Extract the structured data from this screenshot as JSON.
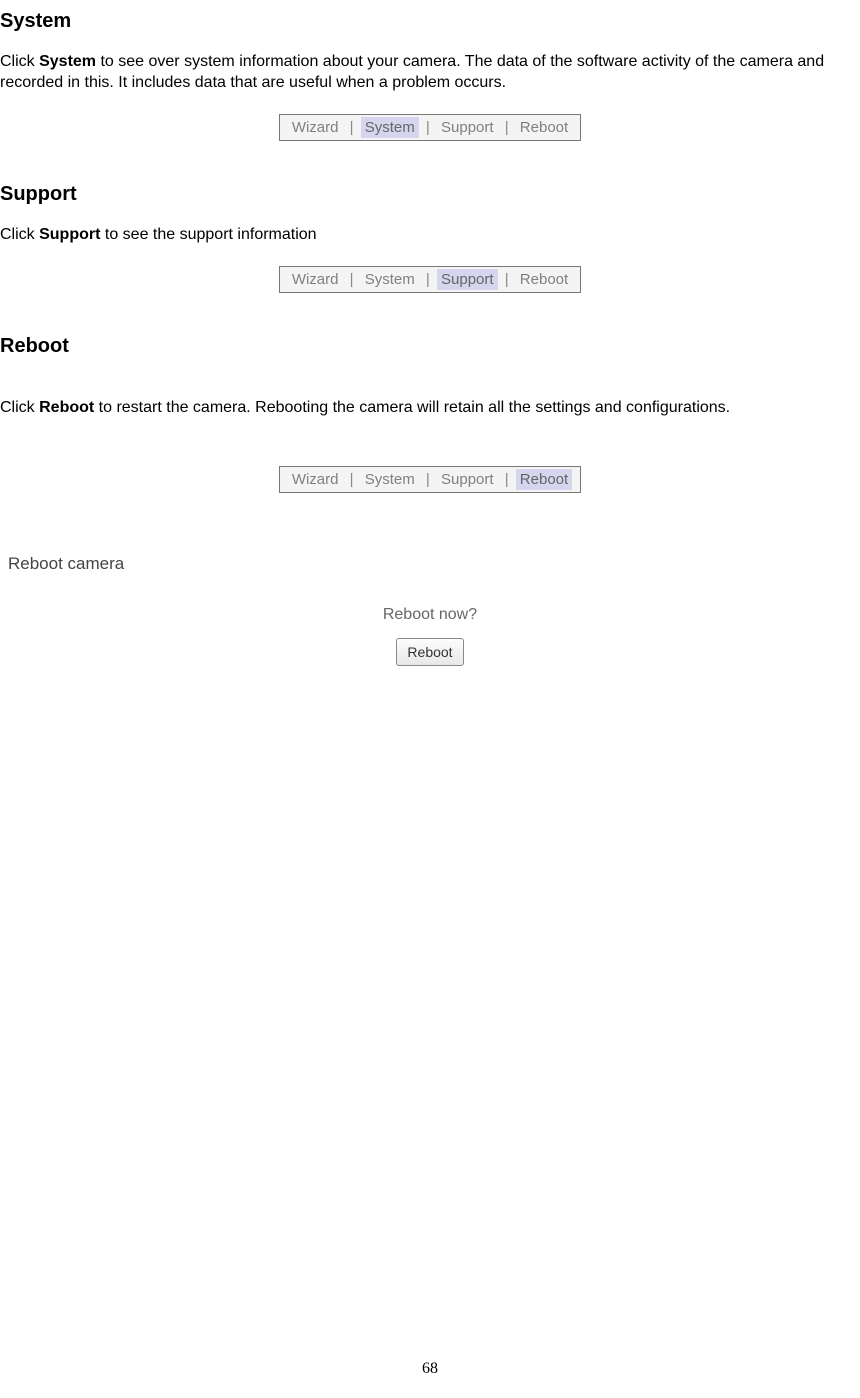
{
  "sections": {
    "system": {
      "heading": "System",
      "para_prefix": "Click ",
      "para_bold": "System",
      "para_suffix": " to see over system information about your camera. The data of the software activity of the camera and recorded in this. It includes data that are useful when a problem occurs."
    },
    "support": {
      "heading": "Support",
      "para_prefix": "Click ",
      "para_bold": "Support",
      "para_suffix": " to see the support information"
    },
    "reboot": {
      "heading": "Reboot",
      "para_prefix": "Click ",
      "para_bold": "Reboot",
      "para_suffix": " to restart the camera. Rebooting the camera will retain all the settings and configurations."
    }
  },
  "tabs": {
    "wizard": "Wizard",
    "system": "System",
    "support": "Support",
    "reboot": "Reboot",
    "separator": "|"
  },
  "reboot_panel": {
    "title": "Reboot camera",
    "question": "Reboot now?",
    "button": "Reboot"
  },
  "page_number": "68"
}
